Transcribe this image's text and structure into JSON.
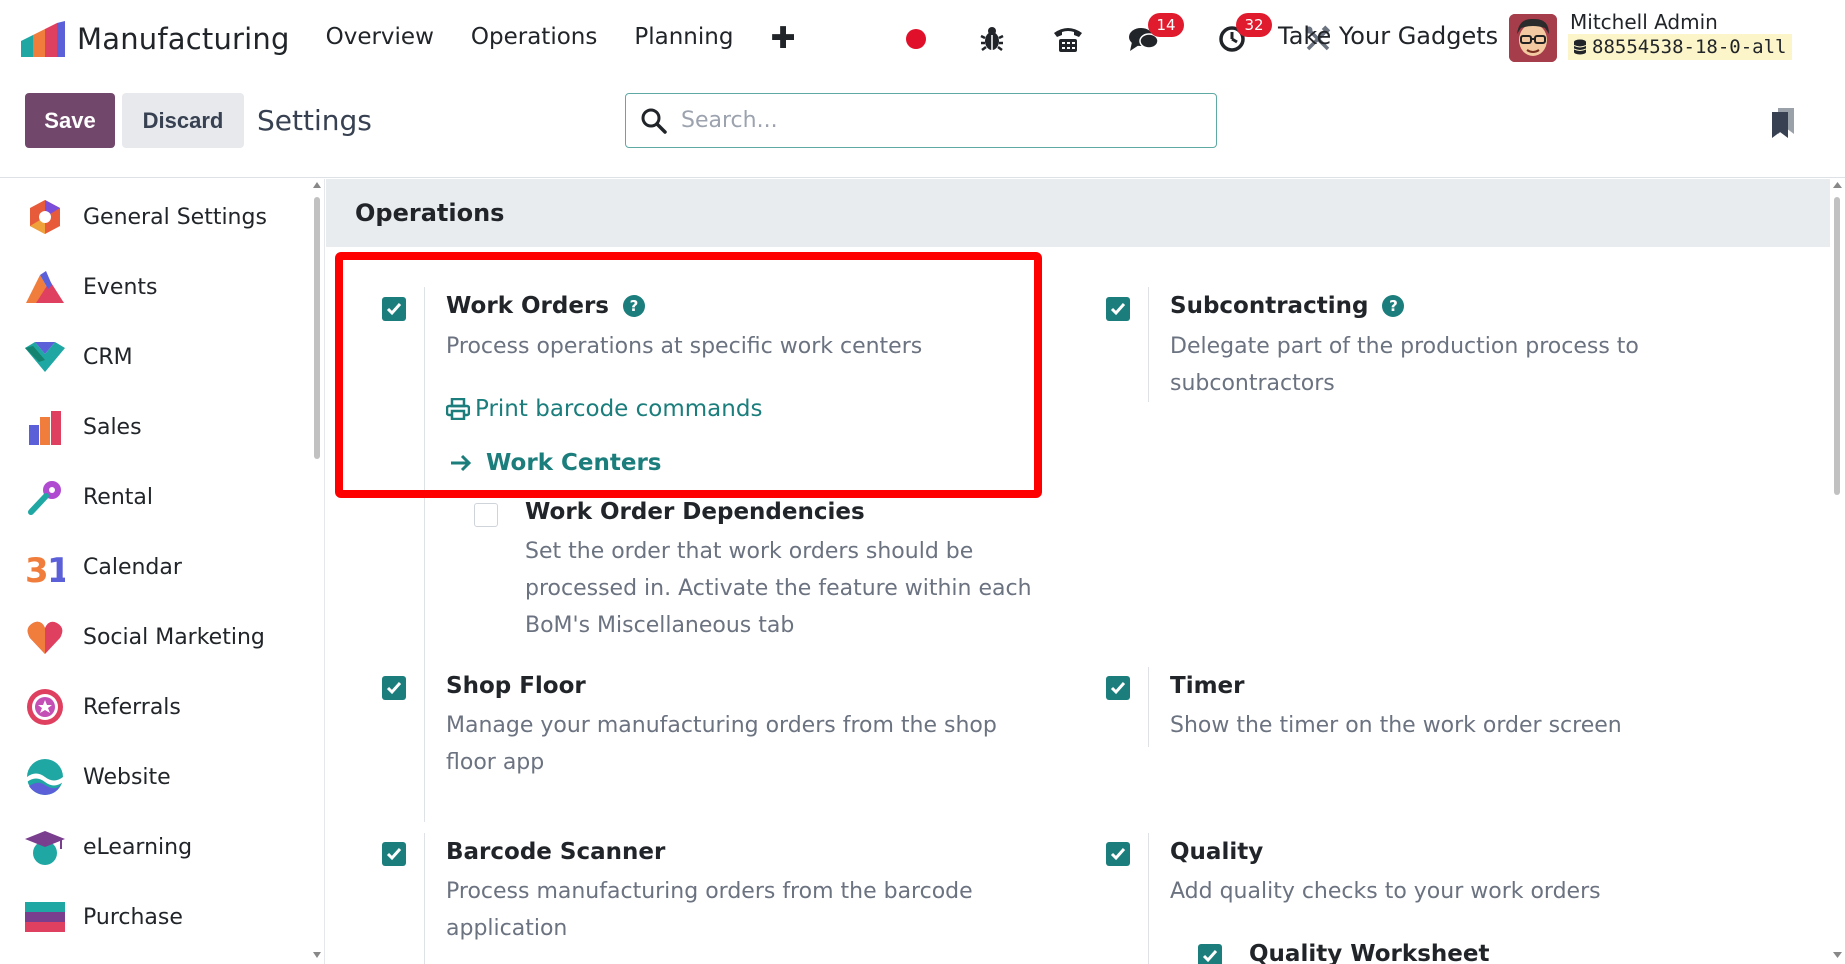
{
  "navbar": {
    "app_name": "Manufacturing",
    "menu": [
      "Overview",
      "Operations",
      "Planning"
    ],
    "add_icon": "plus-icon",
    "messages_count": "14",
    "activities_count": "32",
    "company": "Take Your Gadgets",
    "user_name": "Mitchell Admin",
    "db_name": "88554538-18-0-all"
  },
  "control": {
    "save_label": "Save",
    "discard_label": "Discard",
    "title": "Settings",
    "search_placeholder": "Search..."
  },
  "sidebar": {
    "items": [
      {
        "label": "General Settings",
        "icon": "general-settings-icon"
      },
      {
        "label": "Events",
        "icon": "events-icon"
      },
      {
        "label": "CRM",
        "icon": "crm-icon"
      },
      {
        "label": "Sales",
        "icon": "sales-icon"
      },
      {
        "label": "Rental",
        "icon": "rental-icon"
      },
      {
        "label": "Calendar",
        "icon": "calendar-icon"
      },
      {
        "label": "Social Marketing",
        "icon": "social-marketing-icon"
      },
      {
        "label": "Referrals",
        "icon": "referrals-icon"
      },
      {
        "label": "Website",
        "icon": "website-icon"
      },
      {
        "label": "eLearning",
        "icon": "elearning-icon"
      },
      {
        "label": "Purchase",
        "icon": "purchase-icon"
      }
    ]
  },
  "main": {
    "section_title": "Operations",
    "settings": {
      "work_orders": {
        "title": "Work Orders",
        "desc": "Process operations at specific work centers",
        "checked": true,
        "link_print": "Print barcode commands",
        "link_centers": "Work Centers"
      },
      "work_order_dependencies": {
        "title": "Work Order Dependencies",
        "desc": "Set the order that work orders should be processed in. Activate the feature within each BoM's Miscellaneous tab",
        "checked": false
      },
      "subcontracting": {
        "title": "Subcontracting",
        "desc": "Delegate part of the production process to subcontractors",
        "checked": true
      },
      "shop_floor": {
        "title": "Shop Floor",
        "desc": "Manage your manufacturing orders from the shop floor app",
        "checked": true
      },
      "timer": {
        "title": "Timer",
        "desc": "Show the timer on the work order screen",
        "checked": true
      },
      "barcode_scanner": {
        "title": "Barcode Scanner",
        "desc": "Process manufacturing orders from the barcode application",
        "checked": true
      },
      "quality": {
        "title": "Quality",
        "desc": "Add quality checks to your work orders",
        "checked": true
      },
      "quality_worksheet": {
        "title": "Quality Worksheet",
        "checked": true
      }
    }
  }
}
